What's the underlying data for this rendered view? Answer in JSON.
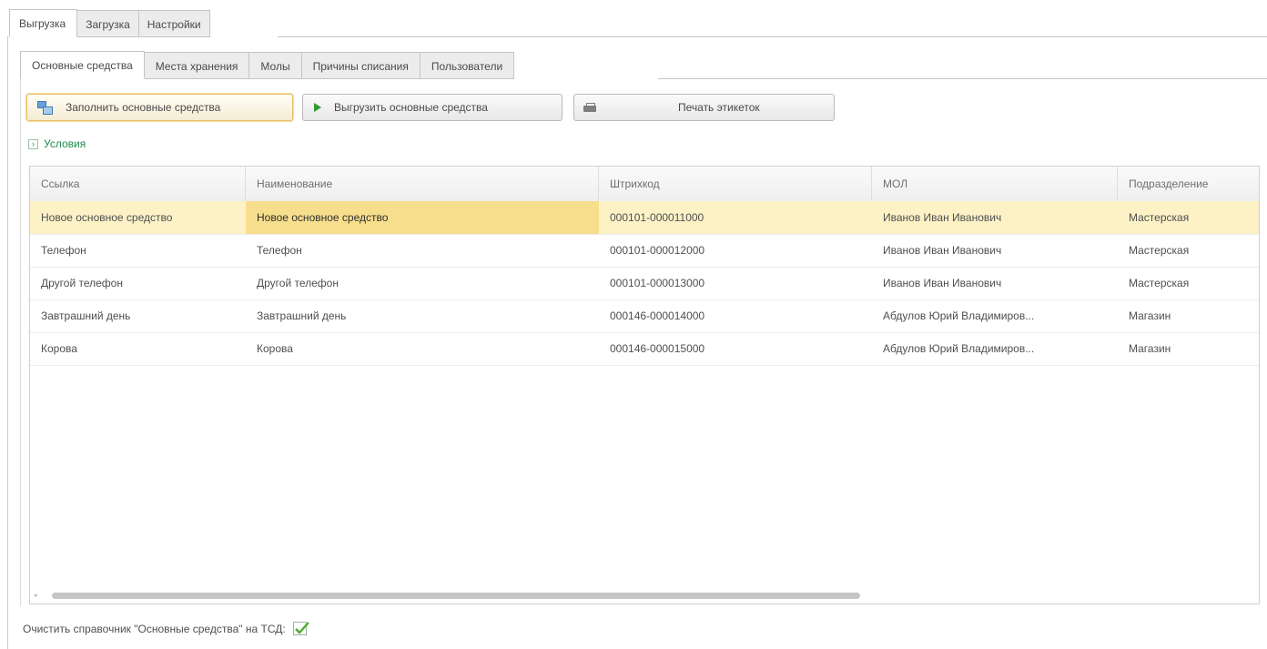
{
  "top_tabs": [
    {
      "label": "Выгрузка",
      "active": true
    },
    {
      "label": "Загрузка",
      "active": false
    },
    {
      "label": "Настройки",
      "active": false
    }
  ],
  "inner_tabs": [
    {
      "label": "Основные средства",
      "active": true
    },
    {
      "label": "Места хранения",
      "active": false
    },
    {
      "label": "Молы",
      "active": false
    },
    {
      "label": "Причины списания",
      "active": false
    },
    {
      "label": "Пользователи",
      "active": false
    }
  ],
  "toolbar": {
    "fill_label": "Заполнить основные средства",
    "fill_icon": "fill-table-icon",
    "export_label": "Выгрузить основные средства",
    "export_icon": "play-icon",
    "print_label": "Печать этикеток",
    "print_icon": "printer-icon"
  },
  "conditions": {
    "label": "Условия",
    "icon": "expand-icon"
  },
  "table": {
    "columns": [
      "Ссылка",
      "Наименование",
      "Штрихкод",
      "МОЛ",
      "Подразделение"
    ],
    "rows": [
      {
        "link": "Новое основное средство",
        "name": "Новое основное средство",
        "barcode": "000101-000011000",
        "mol": "Иванов Иван Иванович",
        "dept": "Мастерская"
      },
      {
        "link": "Телефон",
        "name": "Телефон",
        "barcode": "000101-000012000",
        "mol": "Иванов Иван Иванович",
        "dept": "Мастерская"
      },
      {
        "link": "Другой телефон",
        "name": "Другой телефон",
        "barcode": "000101-000013000",
        "mol": "Иванов Иван Иванович",
        "dept": "Мастерская"
      },
      {
        "link": "Завтрашний день",
        "name": "Завтрашний день",
        "barcode": "000146-000014000",
        "mol": "Абдулов Юрий Владимиров...",
        "dept": "Магазин"
      },
      {
        "link": "Корова",
        "name": "Корова",
        "barcode": "000146-000015000",
        "mol": "Абдулов Юрий Владимиров...",
        "dept": "Магазин"
      }
    ],
    "selected_row": 0
  },
  "clear_option": {
    "label": "Очистить справочник \"Основные средства\" на ТСД:",
    "checked": true
  },
  "colors": {
    "accent_green": "#1e8a4a",
    "selected_row": "#fcf2c6",
    "current_cell": "#f7de8c",
    "check_green": "#4caf2e"
  }
}
